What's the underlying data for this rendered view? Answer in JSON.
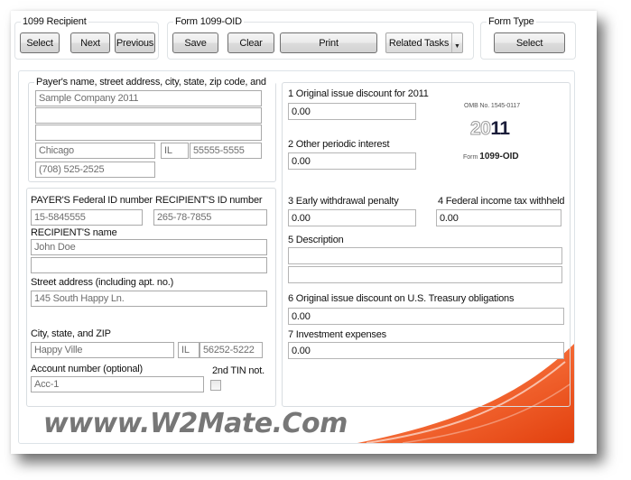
{
  "toolbar": {
    "recipient_group": {
      "title": "1099 Recipient",
      "select_label": "Select",
      "next_label": "Next",
      "previous_label": "Previous"
    },
    "form_group": {
      "title": "Form 1099-OID",
      "save_label": "Save",
      "clear_label": "Clear",
      "print_label": "Print",
      "related_tasks_label": "Related Tasks",
      "dropdown_arrow": "▼"
    },
    "form_type_group": {
      "title": "Form Type",
      "select_label": "Select"
    }
  },
  "payer": {
    "legend": "Payer's name, street address, city, state, zip code, and Tel. #",
    "name": "Sample Company 2011",
    "address1": "",
    "address2": "",
    "city": "Chicago",
    "state": "IL",
    "zip": "55555-5555",
    "phone": "(708) 525-2525"
  },
  "recipient": {
    "payer_fid_label": "PAYER'S Federal ID number",
    "payer_fid": "15-5845555",
    "recipient_id_label": "RECIPIENT'S ID number",
    "recipient_id": "265-78-7855",
    "name_label": "RECIPIENT'S name",
    "name1": "John Doe",
    "name2": "",
    "street_label": "Street address (including apt. no.)",
    "street": "145 South Happy Ln.",
    "city_label": "City, state, and ZIP",
    "city": "Happy Ville",
    "state": "IL",
    "zip": "56252-5222",
    "account_label": "Account number (optional)",
    "account": "Acc-1",
    "tin_label": "2nd TIN not.",
    "tin_checked": false
  },
  "boxes": {
    "box1_label": "1 Original issue discount for 2011",
    "box1": "0.00",
    "box2_label": "2 Other periodic interest",
    "box2": "0.00",
    "box3_label": "3 Early withdrawal penalty",
    "box3": "0.00",
    "box4_label": "4 Federal income tax withheld",
    "box4": "0.00",
    "box5_label": "5 Description",
    "box5_line1": "",
    "box5_line2": "",
    "box6_label": "6 Original issue discount on U.S. Treasury obligations",
    "box6": "0.00",
    "box7_label": "7 Investment expenses",
    "box7": "0.00"
  },
  "form_header": {
    "omb": "OMB No. 1545-0117",
    "year_prefix": "20",
    "year_suffix": "11",
    "form_prefix": "Form",
    "form_name": "1099-OID"
  },
  "watermark": "wwww.W2Mate.Com",
  "colors": {
    "accent_orange": "#f15a24",
    "watermark_gray": "#777777"
  }
}
